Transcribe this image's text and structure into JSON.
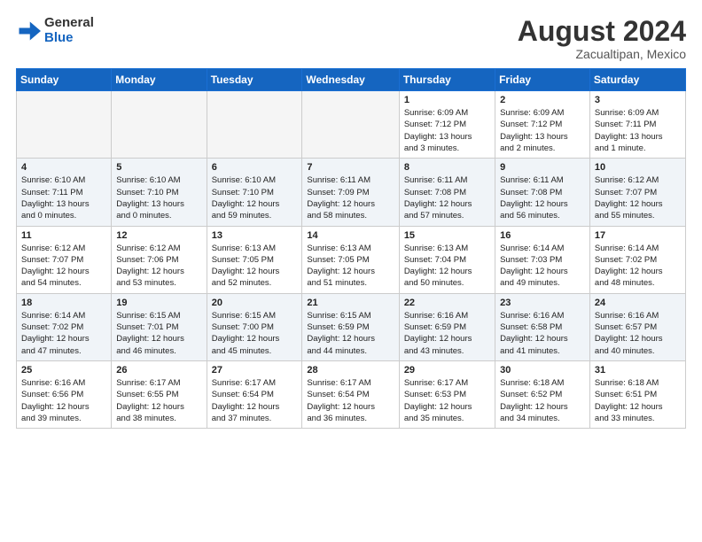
{
  "header": {
    "logo_general": "General",
    "logo_blue": "Blue",
    "month_year": "August 2024",
    "location": "Zacualtipan, Mexico"
  },
  "weekdays": [
    "Sunday",
    "Monday",
    "Tuesday",
    "Wednesday",
    "Thursday",
    "Friday",
    "Saturday"
  ],
  "weeks": [
    [
      {
        "day": "",
        "info": ""
      },
      {
        "day": "",
        "info": ""
      },
      {
        "day": "",
        "info": ""
      },
      {
        "day": "",
        "info": ""
      },
      {
        "day": "1",
        "info": "Sunrise: 6:09 AM\nSunset: 7:12 PM\nDaylight: 13 hours\nand 3 minutes."
      },
      {
        "day": "2",
        "info": "Sunrise: 6:09 AM\nSunset: 7:12 PM\nDaylight: 13 hours\nand 2 minutes."
      },
      {
        "day": "3",
        "info": "Sunrise: 6:09 AM\nSunset: 7:11 PM\nDaylight: 13 hours\nand 1 minute."
      }
    ],
    [
      {
        "day": "4",
        "info": "Sunrise: 6:10 AM\nSunset: 7:11 PM\nDaylight: 13 hours\nand 0 minutes."
      },
      {
        "day": "5",
        "info": "Sunrise: 6:10 AM\nSunset: 7:10 PM\nDaylight: 13 hours\nand 0 minutes."
      },
      {
        "day": "6",
        "info": "Sunrise: 6:10 AM\nSunset: 7:10 PM\nDaylight: 12 hours\nand 59 minutes."
      },
      {
        "day": "7",
        "info": "Sunrise: 6:11 AM\nSunset: 7:09 PM\nDaylight: 12 hours\nand 58 minutes."
      },
      {
        "day": "8",
        "info": "Sunrise: 6:11 AM\nSunset: 7:08 PM\nDaylight: 12 hours\nand 57 minutes."
      },
      {
        "day": "9",
        "info": "Sunrise: 6:11 AM\nSunset: 7:08 PM\nDaylight: 12 hours\nand 56 minutes."
      },
      {
        "day": "10",
        "info": "Sunrise: 6:12 AM\nSunset: 7:07 PM\nDaylight: 12 hours\nand 55 minutes."
      }
    ],
    [
      {
        "day": "11",
        "info": "Sunrise: 6:12 AM\nSunset: 7:07 PM\nDaylight: 12 hours\nand 54 minutes."
      },
      {
        "day": "12",
        "info": "Sunrise: 6:12 AM\nSunset: 7:06 PM\nDaylight: 12 hours\nand 53 minutes."
      },
      {
        "day": "13",
        "info": "Sunrise: 6:13 AM\nSunset: 7:05 PM\nDaylight: 12 hours\nand 52 minutes."
      },
      {
        "day": "14",
        "info": "Sunrise: 6:13 AM\nSunset: 7:05 PM\nDaylight: 12 hours\nand 51 minutes."
      },
      {
        "day": "15",
        "info": "Sunrise: 6:13 AM\nSunset: 7:04 PM\nDaylight: 12 hours\nand 50 minutes."
      },
      {
        "day": "16",
        "info": "Sunrise: 6:14 AM\nSunset: 7:03 PM\nDaylight: 12 hours\nand 49 minutes."
      },
      {
        "day": "17",
        "info": "Sunrise: 6:14 AM\nSunset: 7:02 PM\nDaylight: 12 hours\nand 48 minutes."
      }
    ],
    [
      {
        "day": "18",
        "info": "Sunrise: 6:14 AM\nSunset: 7:02 PM\nDaylight: 12 hours\nand 47 minutes."
      },
      {
        "day": "19",
        "info": "Sunrise: 6:15 AM\nSunset: 7:01 PM\nDaylight: 12 hours\nand 46 minutes."
      },
      {
        "day": "20",
        "info": "Sunrise: 6:15 AM\nSunset: 7:00 PM\nDaylight: 12 hours\nand 45 minutes."
      },
      {
        "day": "21",
        "info": "Sunrise: 6:15 AM\nSunset: 6:59 PM\nDaylight: 12 hours\nand 44 minutes."
      },
      {
        "day": "22",
        "info": "Sunrise: 6:16 AM\nSunset: 6:59 PM\nDaylight: 12 hours\nand 43 minutes."
      },
      {
        "day": "23",
        "info": "Sunrise: 6:16 AM\nSunset: 6:58 PM\nDaylight: 12 hours\nand 41 minutes."
      },
      {
        "day": "24",
        "info": "Sunrise: 6:16 AM\nSunset: 6:57 PM\nDaylight: 12 hours\nand 40 minutes."
      }
    ],
    [
      {
        "day": "25",
        "info": "Sunrise: 6:16 AM\nSunset: 6:56 PM\nDaylight: 12 hours\nand 39 minutes."
      },
      {
        "day": "26",
        "info": "Sunrise: 6:17 AM\nSunset: 6:55 PM\nDaylight: 12 hours\nand 38 minutes."
      },
      {
        "day": "27",
        "info": "Sunrise: 6:17 AM\nSunset: 6:54 PM\nDaylight: 12 hours\nand 37 minutes."
      },
      {
        "day": "28",
        "info": "Sunrise: 6:17 AM\nSunset: 6:54 PM\nDaylight: 12 hours\nand 36 minutes."
      },
      {
        "day": "29",
        "info": "Sunrise: 6:17 AM\nSunset: 6:53 PM\nDaylight: 12 hours\nand 35 minutes."
      },
      {
        "day": "30",
        "info": "Sunrise: 6:18 AM\nSunset: 6:52 PM\nDaylight: 12 hours\nand 34 minutes."
      },
      {
        "day": "31",
        "info": "Sunrise: 6:18 AM\nSunset: 6:51 PM\nDaylight: 12 hours\nand 33 minutes."
      }
    ]
  ]
}
